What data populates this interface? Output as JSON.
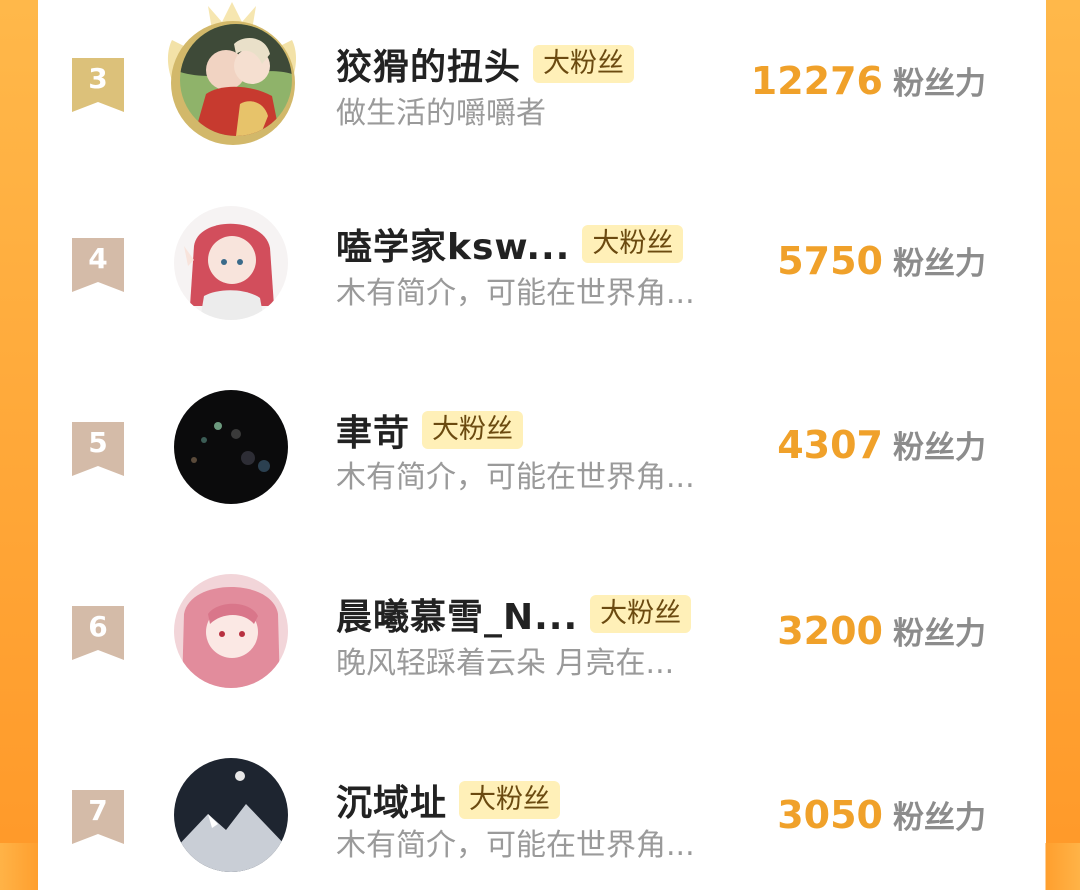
{
  "list": {
    "score_unit": "粉丝力",
    "badge_label": "大粉丝",
    "colors": {
      "accent_orange": "#ff9f2e",
      "score_gold": "#f0a12a",
      "badge_bg": "#fff0b8",
      "rank_top3": "#d8b96a",
      "rank_other": "#cdb39e"
    },
    "rows": [
      {
        "rank": "3",
        "name": "狡猾的扭头",
        "badge": "大粉丝",
        "bio": "做生活的嚼嚼者",
        "score": "12276",
        "has_crown": true
      },
      {
        "rank": "4",
        "name": "嗑学家ksw...",
        "badge": "大粉丝",
        "bio": "木有简介，可能在世界角...",
        "score": "5750",
        "has_crown": false
      },
      {
        "rank": "5",
        "name": "聿苛",
        "badge": "大粉丝",
        "bio": "木有简介，可能在世界角...",
        "score": "4307",
        "has_crown": false
      },
      {
        "rank": "6",
        "name": "晨曦慕雪_N...",
        "badge": "大粉丝",
        "bio": "晚风轻踩着云朵 月亮在...",
        "score": "3200",
        "has_crown": false
      },
      {
        "rank": "7",
        "name": "沉域址",
        "badge": "大粉丝",
        "bio": "木有简介，可能在世界角...",
        "score": "3050",
        "has_crown": false
      }
    ]
  }
}
